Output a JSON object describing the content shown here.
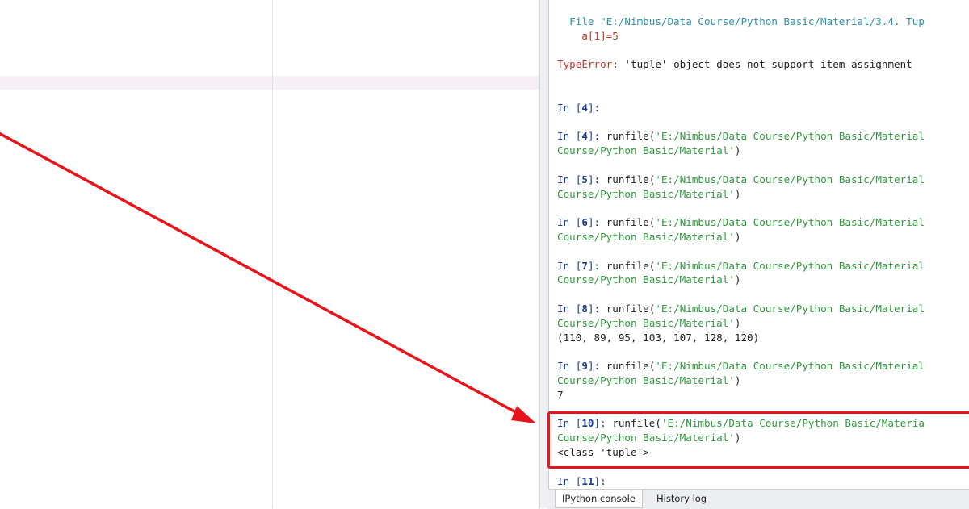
{
  "console": {
    "lines": [
      [
        {
          "c": "path",
          "t": "  File \"E:/Nimbus/Data Course/Python Basic/Material/3.4. Tup"
        }
      ],
      [
        {
          "c": "err",
          "t": "    a[1]=5"
        }
      ],
      [],
      [
        {
          "c": "err",
          "t": "TypeError"
        },
        {
          "c": "",
          "t": ": 'tuple' object does not support item assignment"
        }
      ],
      [],
      [],
      [
        {
          "c": "prompt",
          "t": "In ["
        },
        {
          "c": "num",
          "t": "4"
        },
        {
          "c": "prompt",
          "t": "]:"
        }
      ],
      [],
      [
        {
          "c": "prompt",
          "t": "In ["
        },
        {
          "c": "num",
          "t": "4"
        },
        {
          "c": "prompt",
          "t": "]:"
        },
        {
          "c": "",
          "t": " runfile("
        },
        {
          "c": "str",
          "t": "'E:/Nimbus/Data Course/Python Basic/Material"
        }
      ],
      [
        {
          "c": "str",
          "t": "Course/Python Basic/Material'"
        },
        {
          "c": "",
          "t": ")"
        }
      ],
      [],
      [
        {
          "c": "prompt",
          "t": "In ["
        },
        {
          "c": "num",
          "t": "5"
        },
        {
          "c": "prompt",
          "t": "]:"
        },
        {
          "c": "",
          "t": " runfile("
        },
        {
          "c": "str",
          "t": "'E:/Nimbus/Data Course/Python Basic/Material"
        }
      ],
      [
        {
          "c": "str",
          "t": "Course/Python Basic/Material'"
        },
        {
          "c": "",
          "t": ")"
        }
      ],
      [],
      [
        {
          "c": "prompt",
          "t": "In ["
        },
        {
          "c": "num",
          "t": "6"
        },
        {
          "c": "prompt",
          "t": "]:"
        },
        {
          "c": "",
          "t": " runfile("
        },
        {
          "c": "str",
          "t": "'E:/Nimbus/Data Course/Python Basic/Material"
        }
      ],
      [
        {
          "c": "str",
          "t": "Course/Python Basic/Material'"
        },
        {
          "c": "",
          "t": ")"
        }
      ],
      [],
      [
        {
          "c": "prompt",
          "t": "In ["
        },
        {
          "c": "num",
          "t": "7"
        },
        {
          "c": "prompt",
          "t": "]:"
        },
        {
          "c": "",
          "t": " runfile("
        },
        {
          "c": "str",
          "t": "'E:/Nimbus/Data Course/Python Basic/Material"
        }
      ],
      [
        {
          "c": "str",
          "t": "Course/Python Basic/Material'"
        },
        {
          "c": "",
          "t": ")"
        }
      ],
      [],
      [
        {
          "c": "prompt",
          "t": "In ["
        },
        {
          "c": "num",
          "t": "8"
        },
        {
          "c": "prompt",
          "t": "]:"
        },
        {
          "c": "",
          "t": " runfile("
        },
        {
          "c": "str",
          "t": "'E:/Nimbus/Data Course/Python Basic/Material"
        }
      ],
      [
        {
          "c": "str",
          "t": "Course/Python Basic/Material'"
        },
        {
          "c": "",
          "t": ")"
        }
      ],
      [
        {
          "c": "",
          "t": "(110, 89, 95, 103, 107, 128, 120)"
        }
      ],
      [],
      [
        {
          "c": "prompt",
          "t": "In ["
        },
        {
          "c": "num",
          "t": "9"
        },
        {
          "c": "prompt",
          "t": "]:"
        },
        {
          "c": "",
          "t": " runfile("
        },
        {
          "c": "str",
          "t": "'E:/Nimbus/Data Course/Python Basic/Material"
        }
      ],
      [
        {
          "c": "str",
          "t": "Course/Python Basic/Material'"
        },
        {
          "c": "",
          "t": ")"
        }
      ],
      [
        {
          "c": "",
          "t": "7"
        }
      ],
      [],
      [
        {
          "c": "prompt",
          "t": "In ["
        },
        {
          "c": "num",
          "t": "10"
        },
        {
          "c": "prompt",
          "t": "]:"
        },
        {
          "c": "",
          "t": " runfile("
        },
        {
          "c": "str",
          "t": "'E:/Nimbus/Data Course/Python Basic/Materia"
        }
      ],
      [
        {
          "c": "str",
          "t": "Course/Python Basic/Material'"
        },
        {
          "c": "",
          "t": ")"
        }
      ],
      [
        {
          "c": "",
          "t": "<class 'tuple'>"
        }
      ],
      [],
      [
        {
          "c": "prompt",
          "t": "In ["
        },
        {
          "c": "num",
          "t": "11"
        },
        {
          "c": "prompt",
          "t": "]:"
        }
      ]
    ]
  },
  "tabs": [
    {
      "label": "IPython console",
      "active": true
    },
    {
      "label": "History log",
      "active": false
    }
  ],
  "colors": {
    "annotation": "#e8141b",
    "prompt": "#1a3c8f",
    "string": "#2e9a3c",
    "error": "#c0392b"
  },
  "icons": {
    "annotation": "red-arrow"
  }
}
